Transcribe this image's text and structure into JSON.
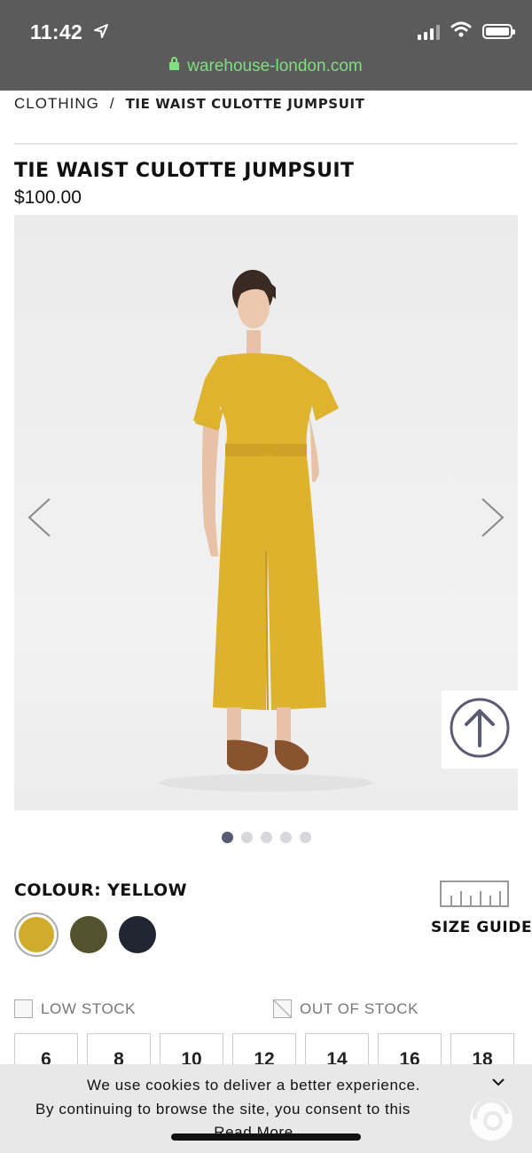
{
  "status_bar": {
    "time": "11:42"
  },
  "browser": {
    "url": "warehouse-london.com"
  },
  "breadcrumb": {
    "parent": "CLOTHING",
    "separator": "/",
    "current": "TIE WAIST CULOTTE JUMPSUIT"
  },
  "product": {
    "title": "TIE WAIST CULOTTE JUMPSUIT",
    "price": "$100.00",
    "image_count": 5,
    "active_image": 1
  },
  "colour": {
    "label": "COLOUR: YELLOW",
    "swatches": [
      {
        "name": "yellow",
        "hex": "#d1ac2c",
        "selected": true
      },
      {
        "name": "khaki",
        "hex": "#54512f",
        "selected": false
      },
      {
        "name": "navy",
        "hex": "#222532",
        "selected": false
      }
    ]
  },
  "size_guide": {
    "label": "SIZE GUIDE"
  },
  "stock_legend": {
    "low": "LOW STOCK",
    "out": "OUT OF STOCK"
  },
  "sizes": [
    "6",
    "8",
    "10",
    "12",
    "14",
    "16",
    "18"
  ],
  "cookie_banner": {
    "line1": "We use cookies to deliver a better experience.",
    "line2": "By continuing to browse the site, you consent to this",
    "more": "Read More"
  },
  "colors": {
    "accent": "#5a5a72",
    "url_green": "#7ee07e",
    "status_bar": "#5b5b5b"
  },
  "icons": [
    "location-arrow-icon",
    "signal-icon",
    "wifi-icon",
    "battery-icon",
    "lock-icon",
    "chevron-left-icon",
    "chevron-right-icon",
    "arrow-up-circle-icon",
    "ruler-icon",
    "chevron-down-icon"
  ]
}
